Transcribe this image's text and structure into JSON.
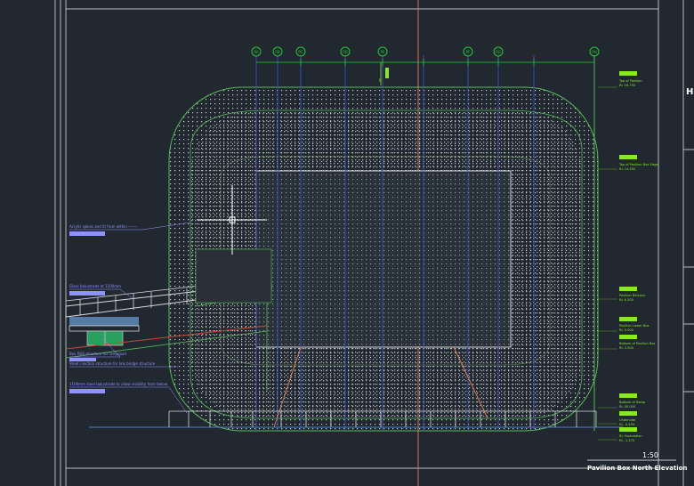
{
  "drawing": {
    "scale": "1:50",
    "title": "Pavilion Box North Elevation",
    "side_letter": "H"
  },
  "grid_bubbles": [
    "PA",
    "PB",
    "PC",
    "PD",
    "PE",
    "PF",
    "PG",
    "PH"
  ],
  "grid_mark": "P",
  "levels": [
    {
      "name": "Top of Pavilion",
      "value": "RL 16.750"
    },
    {
      "name": "Top of Pavilion Box Edge",
      "value": "RL 14.450"
    },
    {
      "name": "Pavilion Balcony",
      "value": "RL 6.300"
    },
    {
      "name": "Pavilion Lower Box",
      "value": "RL 5.000"
    },
    {
      "name": "Bottom of Pavilion Box",
      "value": "RL 3.500"
    },
    {
      "name": "Bottom of Ramp",
      "value": "RL 00.000"
    },
    {
      "name": "Underside",
      "value": "RL -0.450"
    },
    {
      "name": "RL Foundation",
      "value": "RL -1.275"
    }
  ],
  "annotations": [
    "Acrylic spikes and lit from within -------.",
    "Glass balustrade at 1100mm",
    "Box RHS structure for ramp/pod",
    "Steel I section structure for link bridge structure",
    "1100mm steel balustrade to allow visibility from below."
  ],
  "colors": {
    "background": "#212830",
    "frame": "#b8bcc0",
    "grid_line": "#3a50c8",
    "bubble": "#22c830",
    "facade": "#58b85a",
    "dots": "#c9ccd0",
    "label_tag": "#88e828",
    "annotation": "#8f92ff",
    "red_line": "#c84838",
    "orange_line": "#d07858"
  },
  "icons": [
    "crosshair-cursor-icon"
  ]
}
